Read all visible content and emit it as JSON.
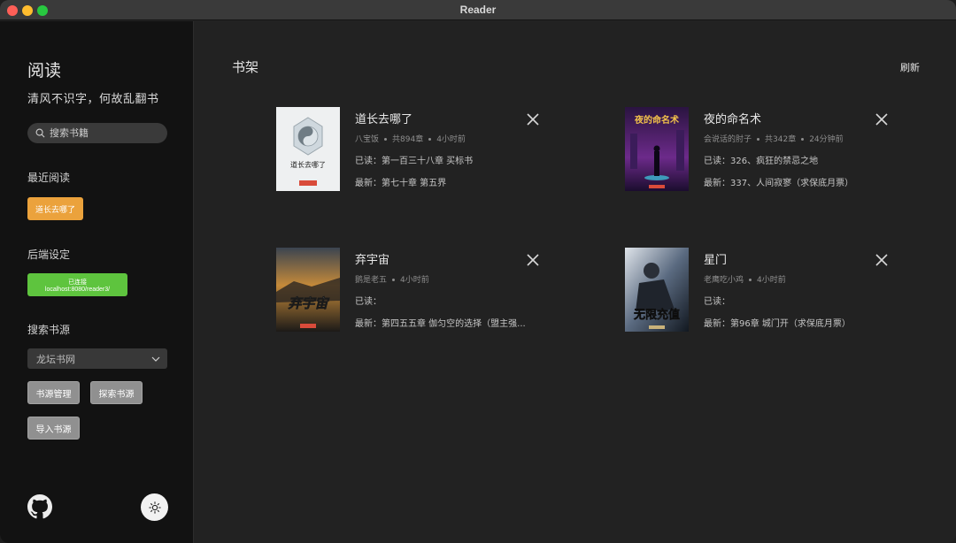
{
  "window": {
    "title": "Reader"
  },
  "sidebar": {
    "app_name": "阅读",
    "tagline": "清风不识字，何故乱翻书",
    "search_placeholder": "搜索书籍",
    "recent_title": "最近阅读",
    "recent_book": "道长去哪了",
    "backend_title": "后端设定",
    "backend_status": "已连接 localhost:8080/reader3/",
    "source_title": "搜索书源",
    "source_selected": "龙坛书网",
    "btn_manage": "书源管理",
    "btn_explore": "探索书源",
    "btn_import": "导入书源"
  },
  "main": {
    "title": "书架",
    "refresh": "刷新",
    "books": [
      {
        "title": "道长去哪了",
        "author": "八宝饭",
        "chapters": "共894章",
        "updated": "4小时前",
        "read": "已读：第一百三十八章 买标书",
        "latest": "最新：第七十章 第五界",
        "cover_text": "道长去哪了"
      },
      {
        "title": "夜的命名术",
        "author": "会说话的肘子",
        "chapters": "共342章",
        "updated": "24分钟前",
        "read": "已读：326、疯狂的禁忌之地",
        "latest": "最新：337、人间寂寥（求保底月票）",
        "cover_text": "夜的命名术"
      },
      {
        "title": "弃宇宙",
        "author": "鹅是老五",
        "chapters": "",
        "updated": "4小时前",
        "read": "已读：",
        "latest": "最新：第四五五章 伽匀空的选择（盟主强...",
        "cover_text": "弃宇宙"
      },
      {
        "title": "星门",
        "author": "老鹰吃小鸡",
        "chapters": "",
        "updated": "4小时前",
        "read": "已读：",
        "latest": "最新：第96章 城门开（求保底月票）",
        "cover_text": "无限充值"
      }
    ]
  },
  "colors": {
    "accent_orange": "#eba23c",
    "accent_green": "#5ec43e",
    "sidebar_bg": "#121212",
    "main_bg": "#222222"
  }
}
